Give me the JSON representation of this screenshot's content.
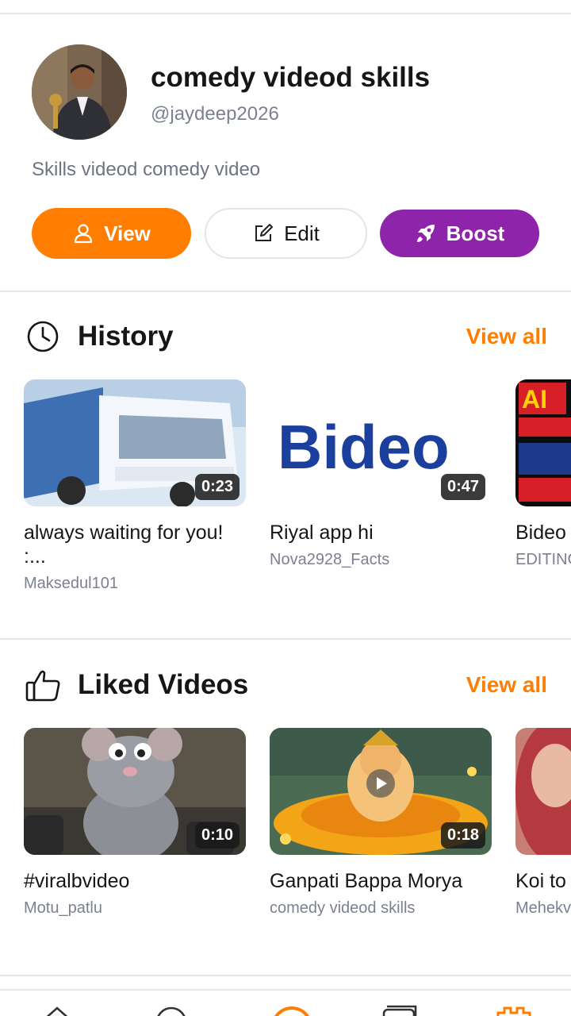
{
  "profile": {
    "name": "comedy videod skills",
    "handle": "@jaydeep2026",
    "bio": "Skills videod comedy video"
  },
  "actions": {
    "view_label": "View",
    "edit_label": "Edit",
    "boost_label": "Boost"
  },
  "history": {
    "title": "History",
    "view_all": "View all",
    "videos": [
      {
        "title": "always waiting for you! :...",
        "channel": "Maksedul101",
        "duration": "0:23"
      },
      {
        "title": "Riyal app hi",
        "channel": "Nova2928_Facts",
        "duration": "0:47",
        "thumb_text": "Bideo"
      },
      {
        "title": "Bideo upload",
        "channel": "EDITING",
        "duration": "",
        "thumb_text": "AI"
      }
    ]
  },
  "liked": {
    "title": "Liked Videos",
    "view_all": "View all",
    "videos": [
      {
        "title": "#viralbvideo",
        "channel": "Motu_patlu",
        "duration": "0:10"
      },
      {
        "title": "Ganpati Bappa Morya",
        "channel": "comedy videod skills",
        "duration": "0:18"
      },
      {
        "title": "Koi to",
        "channel": "Mehekv",
        "duration": ""
      }
    ]
  },
  "nav": {
    "items": [
      "home-icon",
      "play-icon",
      "create-icon",
      "library-icon",
      "profile-icon"
    ],
    "accent": "#ff7d00"
  },
  "colors": {
    "accent": "#ff7d00",
    "boost": "#8e24aa",
    "text": "#161616",
    "muted": "#7b8190"
  }
}
